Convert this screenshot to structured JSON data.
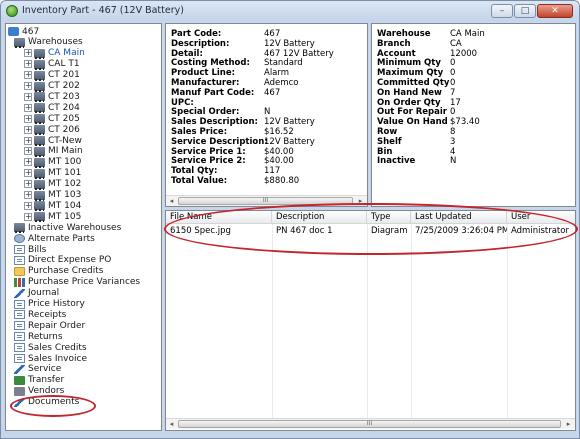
{
  "window": {
    "title": "Inventory Part - 467 (12V Battery)",
    "buttons": {
      "minimize": "–",
      "maximize": "□",
      "close": "✕"
    }
  },
  "tree": {
    "root": "467",
    "warehouses_label": "Warehouses",
    "warehouses": [
      "CA Main",
      "CAL T1",
      "CT 201",
      "CT 202",
      "CT 203",
      "CT 204",
      "CT 205",
      "CT 206",
      "CT-New",
      "MI Main",
      "MT 100",
      "MT 101",
      "MT 102",
      "MT 103",
      "MT 104",
      "MT 105"
    ],
    "selected_warehouse": "CA Main",
    "nodes": [
      "Inactive Warehouses",
      "Alternate Parts",
      "Bills",
      "Direct Expense PO",
      "Purchase Credits",
      "Purchase Price Variances",
      "Journal",
      "Price History",
      "Receipts",
      "Repair Order",
      "Returns",
      "Sales Credits",
      "Sales Invoice",
      "Service",
      "Transfer",
      "Vendors",
      "Documents"
    ]
  },
  "part_details": [
    {
      "label": "Part Code:",
      "value": "467"
    },
    {
      "label": "Description:",
      "value": "12V Battery"
    },
    {
      "label": "Detail:",
      "value": "467 12V Battery"
    },
    {
      "label": "Costing Method:",
      "value": "Standard"
    },
    {
      "label": "Product Line:",
      "value": "Alarm"
    },
    {
      "label": "Manufacturer:",
      "value": "Ademco"
    },
    {
      "label": "Manuf Part Code:",
      "value": "467"
    },
    {
      "label": "UPC:",
      "value": ""
    },
    {
      "label": "Special Order:",
      "value": "N"
    },
    {
      "label": "Sales Description:",
      "value": "12V Battery"
    },
    {
      "label": "Sales Price:",
      "value": "$16.52"
    },
    {
      "label": "Service Description:",
      "value": "12V Battery"
    },
    {
      "label": "Service Price 1:",
      "value": "$40.00"
    },
    {
      "label": "Service Price 2:",
      "value": "$40.00"
    },
    {
      "label": "Total Qty:",
      "value": "117"
    },
    {
      "label": "Total Value:",
      "value": "$880.80"
    }
  ],
  "warehouse_details": [
    {
      "label": "Warehouse",
      "value": "CA Main"
    },
    {
      "label": "Branch",
      "value": "CA"
    },
    {
      "label": "Account",
      "value": "12000"
    },
    {
      "label": "Minimum Qty",
      "value": "0"
    },
    {
      "label": "Maximum Qty",
      "value": "0"
    },
    {
      "label": "Committed Qty",
      "value": "0"
    },
    {
      "label": "On Hand New",
      "value": "7"
    },
    {
      "label": "On Order Qty",
      "value": "17"
    },
    {
      "label": "Out For Repair",
      "value": "0"
    },
    {
      "label": "Value On Hand",
      "value": "$73.40"
    },
    {
      "label": "Row",
      "value": "8"
    },
    {
      "label": "Shelf",
      "value": "3"
    },
    {
      "label": "Bin",
      "value": "4"
    },
    {
      "label": "Inactive",
      "value": "N"
    }
  ],
  "documents": {
    "columns": [
      "File Name",
      "Description",
      "Type",
      "Last Updated",
      "User"
    ],
    "rows": [
      [
        "6150 Spec.jpg",
        "PN 467 doc 1",
        "Diagram",
        "7/25/2009 3:26:04 PM",
        "Administrator"
      ]
    ]
  },
  "scrollbar": {
    "left_arrow": "◂",
    "right_arrow": "▸",
    "grip": "III"
  },
  "colors": {
    "highlight": "#c4242c",
    "selected_text": "#1756b0"
  }
}
